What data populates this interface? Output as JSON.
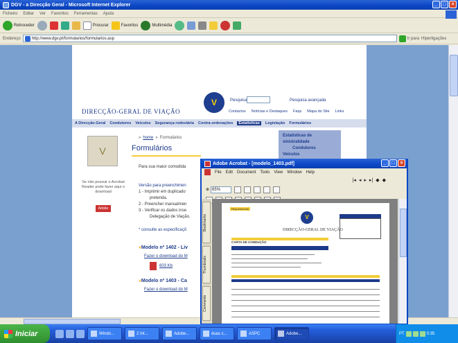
{
  "ie": {
    "title": "DGV - a Direcção Geral - Microsoft Internet Explorer",
    "menu": [
      "Ficheiro",
      "Editar",
      "Ver",
      "Favoritos",
      "Ferramentas",
      "Ajuda"
    ],
    "toolbar": {
      "back": "Retroceder",
      "search": "Procurar",
      "favorites": "Favoritos",
      "media": "Multimédia"
    },
    "address_label": "Endereço",
    "address_value": "http://www.dgv.pt/formularios/formularios.asp",
    "go_label": "Ir para",
    "links_label": "Hiperligações"
  },
  "site": {
    "logo_letter": "V",
    "org_name": "DIRECÇÃO-GERAL DE VIAÇÃO",
    "search_label": "Pesquisa",
    "adv_search": "Pesquisa avançada",
    "top_links": [
      "Contactos",
      "Notícias e Destaques",
      "Faqs",
      "Mapa do Site",
      "Links"
    ],
    "nav": [
      "A Direcção-Geral",
      "Condutores",
      "Veículos",
      "Segurança rodoviária",
      "Contra-ordenações",
      "Estatísticas",
      "Legislação",
      "Formulários"
    ],
    "nav_active_index": 5,
    "breadcrumb_home": "home",
    "breadcrumb_current": "Formulários",
    "page_title": "Formulários",
    "intro": "Para sua maior comodida",
    "instructions_title": "Versão para preenchimen",
    "steps": [
      "1 - Imprimir em duplicado",
      "pretenda.",
      "2 - Preencher manualmen",
      "3 - Verificar os dados inse",
      "Delegação de Viação."
    ],
    "spec_note": "* consulte as especificaçõ",
    "side_note": "Se não possuir o Acrobat Reader pode fazer aqui o download",
    "side_badge": "Adobe",
    "dropdown": [
      "Estatísticas de sinistralidade",
      "Condutores",
      "Veículos"
    ],
    "modelos": [
      {
        "title": "Modelo nº 1402 - Liv",
        "link": "Fazer o download do M",
        "size": "603 Kb"
      },
      {
        "title": "Modelo nº 1403 - Ca",
        "link": "Fazer o download do M"
      }
    ]
  },
  "acrobat": {
    "title": "Adobe Acrobat - [modelo_1403.pdf]",
    "menu": [
      "File",
      "Edit",
      "Document",
      "Tools",
      "View",
      "Window",
      "Help"
    ],
    "zoom": "65%",
    "side_tabs": [
      "Bookmarks",
      "Thumbnails",
      "Comments"
    ],
    "doc": {
      "badge": "Requerimento",
      "org": "DIRECÇÃO-GERAL DE VIAÇÃO",
      "heading": "CARTA DE CONDUÇÃO",
      "logo_letter": "V"
    }
  },
  "taskbar": {
    "start": "Iniciar",
    "tasks": [
      "Windo...",
      "2 Int...",
      "Adobe...",
      "duas c...",
      "ASPC",
      "Adobe..."
    ],
    "tray_lang": "PT",
    "clock": "0:35"
  }
}
